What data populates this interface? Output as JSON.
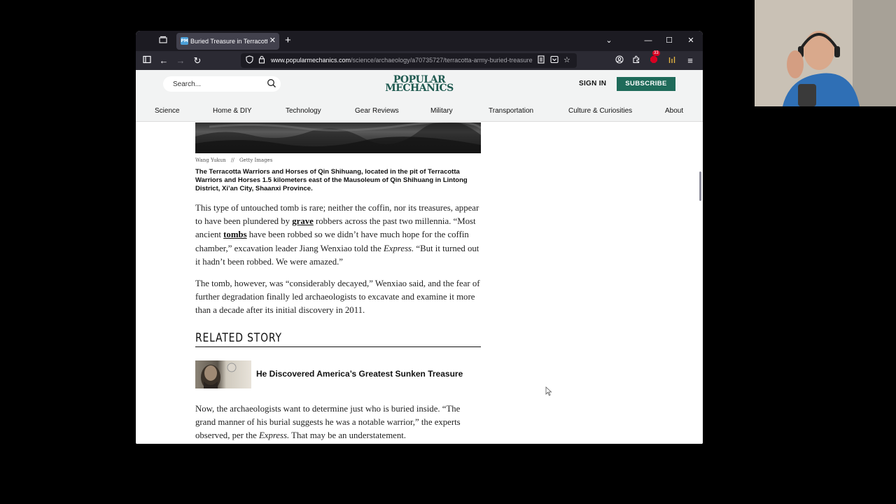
{
  "browser": {
    "tab_title": "Buried Treasure in Terracotta Army",
    "tab_favicon": "PM",
    "url_domain": "www.popularmechanics.com",
    "url_path": "/science/archaeology/a70735727/terracotta-army-buried-treasure",
    "extension_badge": "33",
    "icons": [
      "tab-list-icon",
      "new-tab-icon",
      "list-all-tabs-icon",
      "minimize-icon",
      "maximize-icon",
      "close-window-icon",
      "sidebar-icon",
      "back-icon",
      "forward-icon",
      "reload-icon",
      "shield-icon",
      "lock-icon",
      "reader-view-icon",
      "pocket-icon",
      "bookmark-star-icon",
      "account-icon",
      "extensions-icon",
      "menu-icon"
    ]
  },
  "site": {
    "search_placeholder": "Search...",
    "logo_line1": "POPULAR",
    "logo_line2": "MECHANICS",
    "sign_in": "SIGN IN",
    "subscribe": "SUBSCRIBE",
    "brand_color": "#1f6b5a",
    "nav": [
      "Science",
      "Home & DIY",
      "Technology",
      "Gear Reviews",
      "Military",
      "Transportation",
      "Culture & Curiosities",
      "About"
    ]
  },
  "article": {
    "credit_author": "Wang Yukun",
    "credit_sep": "//",
    "credit_source": "Getty Images",
    "caption": "The Terracotta Warriors and Horses of Qin Shihuang, located in the pit of Terracotta Warriors and Horses 1.5 kilometers east of the Mausoleum of Qin Shihuang in Lintong District, Xi’an City, Shaanxi Province.",
    "p1": {
      "a": "This type of untouched tomb is rare; neither the coffin, nor its treasures, appear to have been plundered by ",
      "link1": "grave",
      "b": " robbers across the past two millennia. “Most ancient ",
      "link2": "tombs",
      "c": " have been robbed so we didn’t have much hope for the coffin chamber,” excavation leader Jiang Wenxiao told the ",
      "em": "Express.",
      "d": " “But it turned out it hadn’t been robbed. We were amazed.”"
    },
    "p2": "The tomb, however, was “considerably decayed,” Wenxiao said, and the fear of further degradation finally led archaeologists to excavate and examine it more than a decade after its initial discovery in 2011.",
    "related_heading": "RELATED STORY",
    "related_link": "He Discovered America’s Greatest Sunken Treasure",
    "p3": {
      "a": "Now, the archaeologists want to determine just who is buried inside. “The grand manner of his burial suggests he was a notable warrior,” the experts observed, per the ",
      "em": "Express.",
      "b": " That may be an understatement."
    }
  }
}
